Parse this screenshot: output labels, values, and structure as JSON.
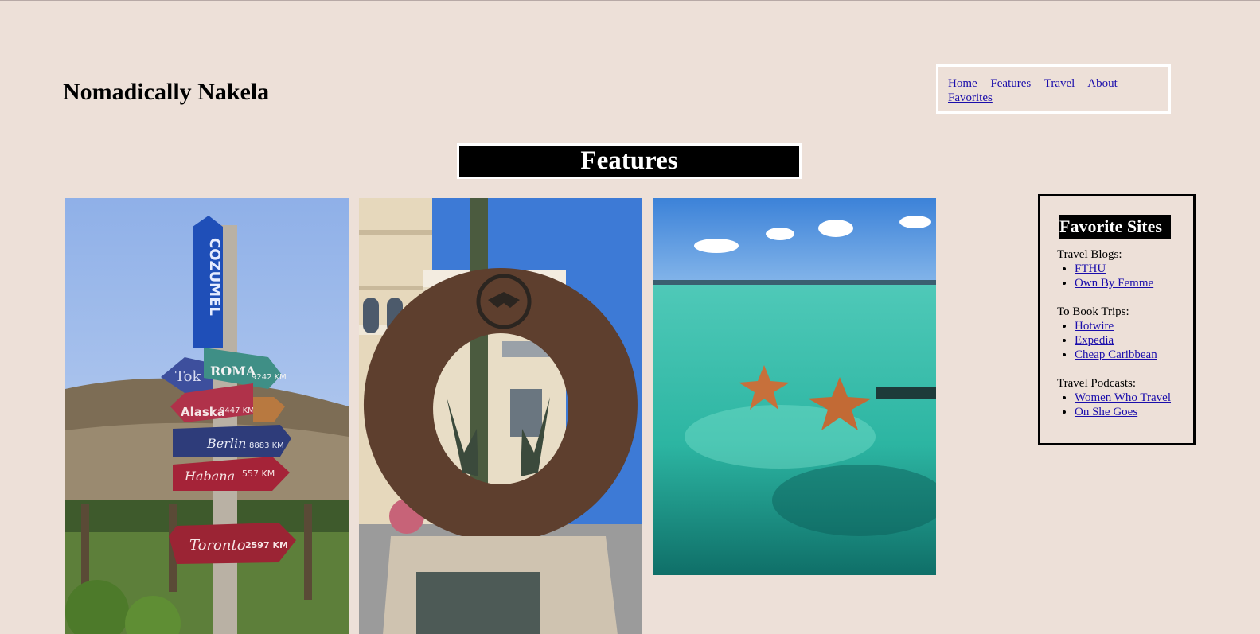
{
  "header": {
    "site_title": "Nomadically Nakela"
  },
  "nav": {
    "items": [
      "Home",
      "Features",
      "Travel",
      "About",
      "Favorites"
    ]
  },
  "features": {
    "banner": "Features"
  },
  "photos": {
    "sign_post": {
      "signs": [
        "COZUMEL",
        "Tok",
        "ROMA",
        "9242 KM",
        "Alaska",
        "9447 KM",
        "Berlin",
        "8883 KM",
        "Habana",
        "557 KM",
        "Toronto",
        "2597 KM"
      ]
    },
    "sculpture": {},
    "starfish": {}
  },
  "favorites": {
    "title": "Favorite Sites",
    "groups": [
      {
        "label": "Travel Blogs:",
        "links": [
          "FTHU",
          "Own By Femme"
        ]
      },
      {
        "label": "To Book Trips:",
        "links": [
          "Hotwire",
          "Expedia",
          "Cheap Caribbean"
        ]
      },
      {
        "label": "Travel Podcasts:",
        "links": [
          "Women Who Travel",
          "On She Goes"
        ]
      }
    ]
  },
  "colors": {
    "background": "#ede0d8",
    "link": "#1a0dab",
    "banner": "#000000"
  }
}
